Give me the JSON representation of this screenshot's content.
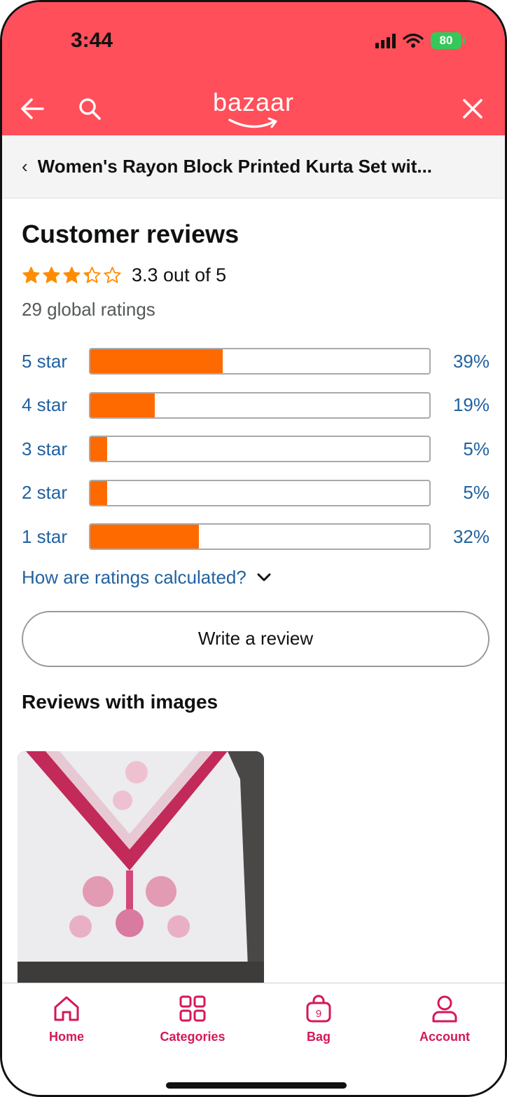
{
  "status_bar": {
    "time": "3:44",
    "battery": "80"
  },
  "header": {
    "logo_text": "bazaar",
    "brand_color": "#ff4f5a"
  },
  "breadcrumb": {
    "title": "Women's Rayon Block Printed Kurta Set wit..."
  },
  "reviews": {
    "heading": "Customer reviews",
    "rating_value": 3.3,
    "rating_text": "3.3 out of 5",
    "global_ratings": "29 global ratings",
    "histogram": [
      {
        "label": "5 star",
        "percent_text": "39%",
        "percent": 39
      },
      {
        "label": "4 star",
        "percent_text": "19%",
        "percent": 19
      },
      {
        "label": "3 star",
        "percent_text": "5%",
        "percent": 5
      },
      {
        "label": "2 star",
        "percent_text": "5%",
        "percent": 5
      },
      {
        "label": "1 star",
        "percent_text": "32%",
        "percent": 32
      }
    ],
    "how_calculated": "How are ratings calculated?",
    "write_review": "Write a review",
    "images_heading": "Reviews with images"
  },
  "bottom_nav": {
    "items": [
      {
        "label": "Home",
        "icon": "home-icon"
      },
      {
        "label": "Categories",
        "icon": "categories-icon"
      },
      {
        "label": "Bag",
        "icon": "bag-icon",
        "badge": "9"
      },
      {
        "label": "Account",
        "icon": "account-icon"
      }
    ],
    "accent_color": "#d6175a"
  },
  "colors": {
    "bar_fill": "#ff6a00",
    "link": "#2162a1",
    "star": "#ff8c00"
  }
}
